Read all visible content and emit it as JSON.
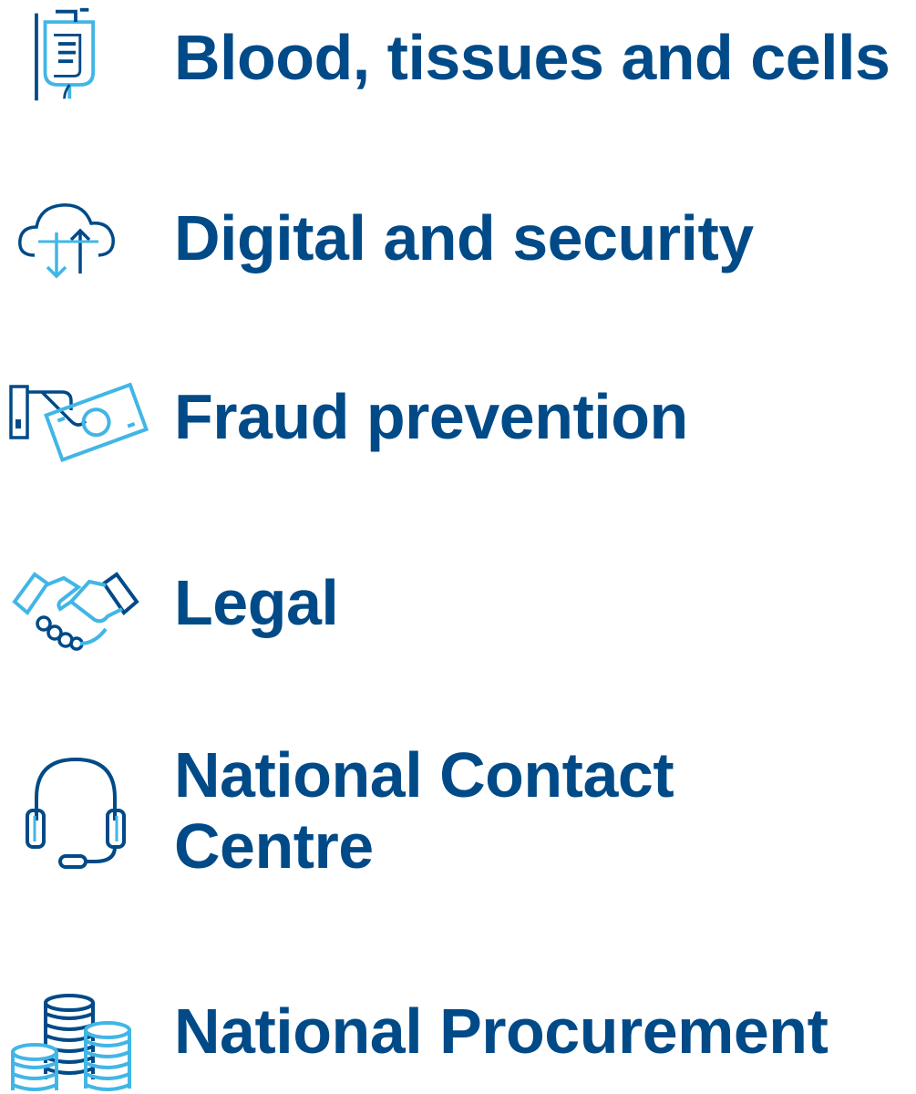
{
  "services": [
    {
      "label": "Blood, tissues and cells",
      "icon": "iv-blood-bag-icon"
    },
    {
      "label": "Digital and security",
      "icon": "cloud-sync-icon"
    },
    {
      "label": "Fraud prevention",
      "icon": "hand-money-icon"
    },
    {
      "label": "Legal",
      "icon": "handshake-icon"
    },
    {
      "label": "National Contact Centre",
      "icon": "headset-icon"
    },
    {
      "label": "National Procurement",
      "icon": "coin-stacks-icon"
    }
  ],
  "colors": {
    "label_text": "#004a88",
    "icon_dark": "#004a88",
    "icon_light": "#41b6e6"
  }
}
